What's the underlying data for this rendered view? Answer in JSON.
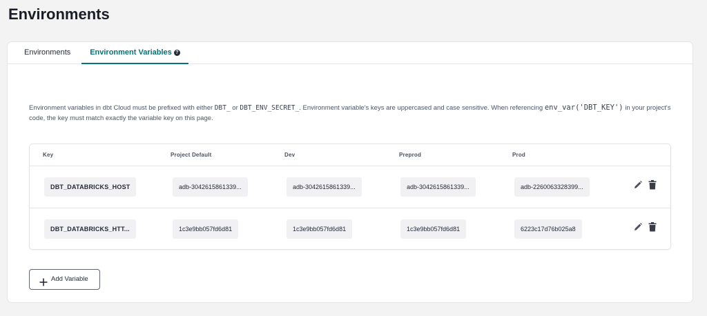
{
  "page": {
    "title": "Environments"
  },
  "tabs": [
    {
      "label": "Environments",
      "active": false
    },
    {
      "label": "Environment Variables",
      "active": true,
      "help_icon": "?"
    }
  ],
  "description": {
    "part1": "Environment variables in dbt Cloud must be prefixed with either ",
    "code1": "DBT_",
    "part2": " or ",
    "code2": "DBT_ENV_SECRET_",
    "part3": ". Environment variable's keys are uppercased and case sensitive. When referencing ",
    "code3": "env_var('DBT_KEY')",
    "part4": " in your project's code, the key must match exactly the variable key on this page."
  },
  "table": {
    "columns": [
      "Key",
      "Project Default",
      "Dev",
      "Preprod",
      "Prod"
    ],
    "rows": [
      {
        "key": "DBT_DATABRICKS_HOST",
        "project_default": "adb-3042615861339...",
        "dev": "adb-3042615861339...",
        "preprod": "adb-3042615861339...",
        "prod": "adb-2260063328399..."
      },
      {
        "key": "DBT_DATABRICKS_HTT...",
        "project_default": "1c3e9bb057fd6d81",
        "dev": "1c3e9bb057fd6d81",
        "preprod": "1c3e9bb057fd6d81",
        "prod": "6223c17d76b025a8"
      }
    ],
    "row_actions": [
      "pencil-icon",
      "trash-icon"
    ]
  },
  "add_button": {
    "label": "Add Variable",
    "icon": "plus-icon"
  },
  "colors": {
    "accent": "#047377",
    "background": "#f3f3f3",
    "cell_bg": "#f1f1f3"
  }
}
